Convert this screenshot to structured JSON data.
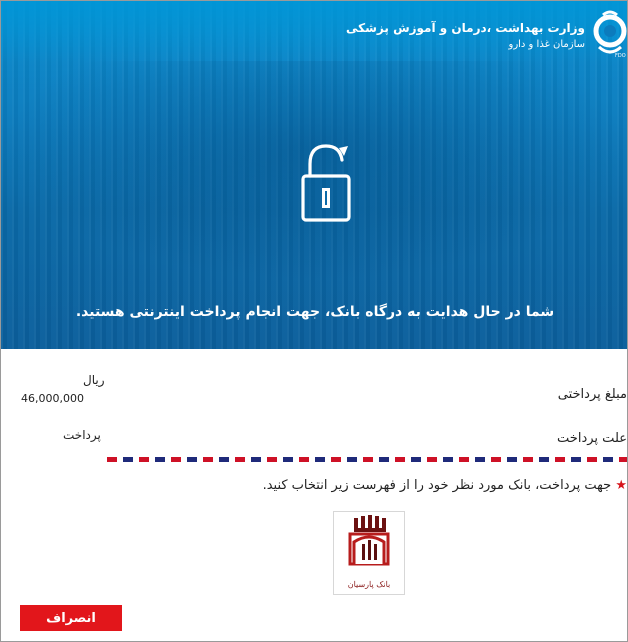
{
  "header": {
    "org_name": "وزارت بهداشت ،درمان و آموزش پزشکی",
    "org_sub": "سازمان غذا و دارو",
    "logo_icon": "ministry-logo-icon",
    "hero_message": "شما در حال هدایت به درگاه بانک، جهت انجام پرداخت اینترنتی هستید."
  },
  "payment": {
    "amount_label": "مبلغ پرداختی",
    "currency": "ریال",
    "amount_value": "46,000,000",
    "reason_label": "علت پرداخت",
    "reason_value": "پرداخت"
  },
  "instructions": {
    "text": "جهت پرداخت، بانک مورد نظر خود را از فهرست زیر انتخاب کنید.",
    "star": "★"
  },
  "banks": [
    {
      "name": "بانک پارسیان",
      "icon": "bank-parsian-logo"
    }
  ],
  "actions": {
    "cancel_label": "انصراف"
  },
  "colors": {
    "hero_blue": "#0b7bbd",
    "cancel_red": "#e2161b",
    "dash_red": "#ce1126",
    "dash_navy": "#1f2a7a"
  }
}
